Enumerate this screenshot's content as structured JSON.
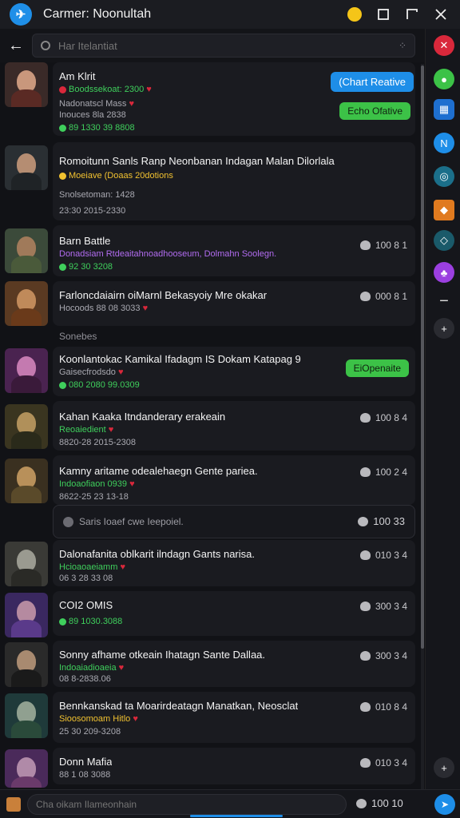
{
  "window": {
    "title": "Carmer: Noonultah",
    "logo_glyph": "✈",
    "controls": [
      "emoji-icon",
      "maximize-icon",
      "restore-icon",
      "close-icon"
    ]
  },
  "search": {
    "placeholder": "Har Itelantiat",
    "option_glyph": "⁘"
  },
  "rail": {
    "bottom_plus": "+"
  },
  "items": [
    {
      "name": "Am Klrit",
      "line1": "Boodssekoat: 2300",
      "line2": "Nadonatscl Mass",
      "line3": "Inouces 8la 2838",
      "line4": "89 1330 39 8808",
      "pill_blue": "(Chart Reative",
      "pill_green": "Echo Ofative",
      "meta": ""
    },
    {
      "name": "Romoitunn Sanls Ranp Neonbanan Indagan Malan Dilorlala",
      "line1": "Moeiave  (Doaas  20dotions",
      "line2": "Snolsetoman: 1428",
      "line3": "23:30  2015-2330",
      "meta": ""
    },
    {
      "name": "Barn Battle",
      "line1": "Donadsiam Rtdeaitahnoadhooseum, Dolmahn Soolegn.",
      "line2": "92 30 3208",
      "meta": "100 8 1"
    },
    {
      "name": "Farloncdaiairn oiMarnl Bekasyoiy Mre okakar",
      "line1": "Hocoods  88 08 3033",
      "meta": "000 8 1"
    },
    {
      "section": "Sonebes"
    },
    {
      "name": "Koonlantokac Kamikal Ifadagm IS Dokam Katapag 9",
      "line1": "Gaisecfrodsdo",
      "line2": "080 2080 99.0309",
      "pill_green": "EiOpenaite",
      "meta": ""
    },
    {
      "name": "Kahan Kaaka Itndanderary erakeain",
      "line1": "Reoaiedient",
      "line2": "8820-28 2015-2308",
      "meta": "100 8 4"
    },
    {
      "name": "Kamny aritame odealehaegn Gente pariea.",
      "line1": "Indoaofiaon  0939",
      "line2": "8622-25 23 13-18",
      "meta": "100 2 4"
    },
    {
      "notice": "Saris Ioaef cwe Ieepoiel.",
      "meta": "100 33"
    },
    {
      "name": "Dalonafanita oblkarit ilndagn Gants narisa.",
      "line1": "Hcioaoaeiamm",
      "line2": "06 3 28 33 08",
      "meta": "010 3 4"
    },
    {
      "name": "COI2 OMIS",
      "line1": "89 1030.3088",
      "meta": "300 3 4"
    },
    {
      "name": "Sonny afhame otkeain Ihatagn Sante Dallaa.",
      "line1": "Indoaiadioaeia",
      "line2": "08 8-2838.06",
      "meta": "300 3 4"
    },
    {
      "name": "Bennkanskad ta  Moarirdeatagn Manatkan, Neosclat",
      "line1": "Sioosomoam  Hitlo",
      "line2": "25 30  209-3208",
      "meta": "010 8 4"
    },
    {
      "name": "Donn Mafia",
      "line1": "88 1 08 3088",
      "meta": "010 3 4"
    }
  ],
  "composer": {
    "placeholder": "Cha oikam Ilameonhain",
    "meta": "100 10"
  },
  "colors": {
    "accent": "#1e8ee8",
    "green": "#3cc247",
    "heart": "#d9283b",
    "purple": "#b26cf0"
  }
}
